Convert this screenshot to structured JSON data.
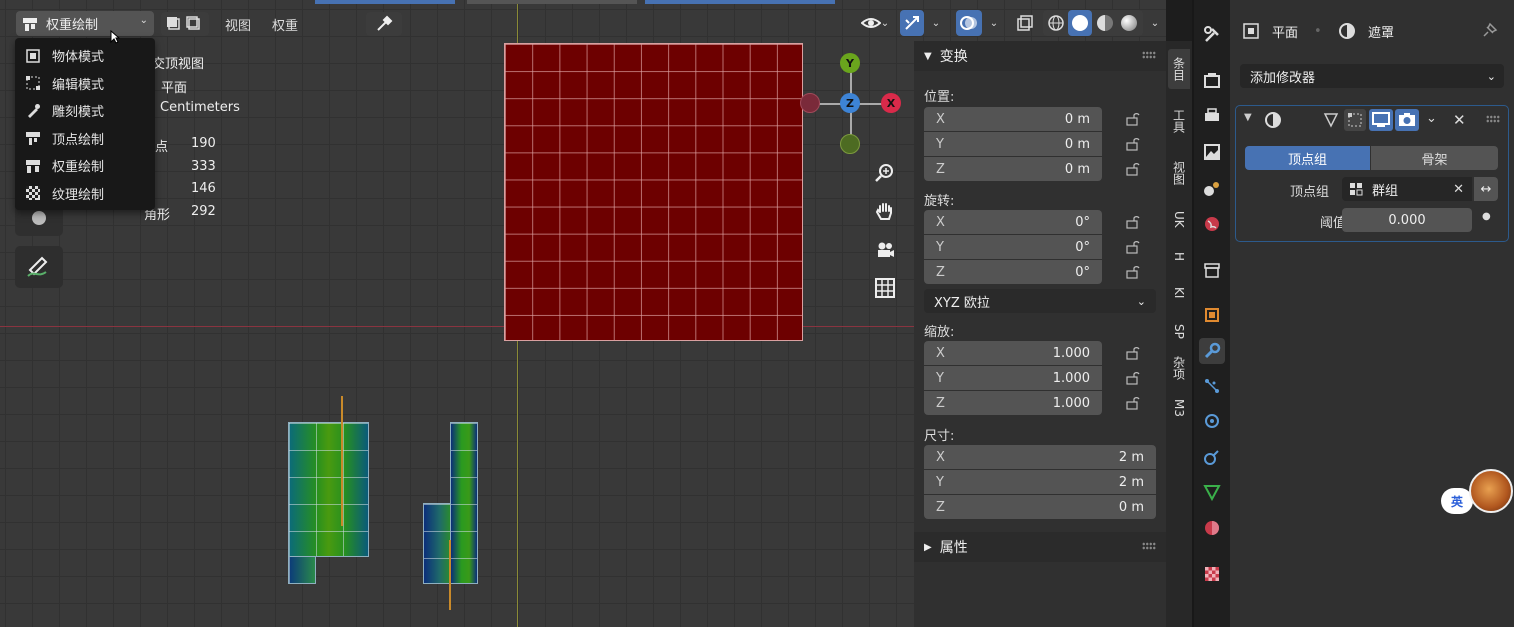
{
  "header": {
    "mode_label": "权重绘制",
    "view_menu": "视图",
    "weight_menu": "权重"
  },
  "mode_menu": {
    "items": [
      {
        "label": "物体模式",
        "icon": "object-mode-icon"
      },
      {
        "label": "编辑模式",
        "icon": "edit-mode-icon"
      },
      {
        "label": "雕刻模式",
        "icon": "sculpt-mode-icon"
      },
      {
        "label": "顶点绘制",
        "icon": "vertex-paint-icon"
      },
      {
        "label": "权重绘制",
        "icon": "weight-paint-icon"
      },
      {
        "label": "纹理绘制",
        "icon": "texture-paint-icon"
      }
    ]
  },
  "overlay": {
    "view_name": "交顶视图",
    "object_name": "平面",
    "units": "Centimeters",
    "stats": [
      {
        "label": "点",
        "value": "190"
      },
      {
        "label": "",
        "value": "333"
      },
      {
        "label": "",
        "value": "146"
      },
      {
        "label": "角形",
        "value": "292"
      }
    ]
  },
  "gizmo": {
    "x_label": "X",
    "y_label": "Y",
    "z_label": "Z"
  },
  "npanel": {
    "transform_title": "变换",
    "location_label": "位置:",
    "location": [
      {
        "axis": "X",
        "value": "0 m"
      },
      {
        "axis": "Y",
        "value": "0 m"
      },
      {
        "axis": "Z",
        "value": "0 m"
      }
    ],
    "rotation_label": "旋转:",
    "rotation": [
      {
        "axis": "X",
        "value": "0°"
      },
      {
        "axis": "Y",
        "value": "0°"
      },
      {
        "axis": "Z",
        "value": "0°"
      }
    ],
    "rotation_mode": "XYZ 欧拉",
    "scale_label": "缩放:",
    "scale": [
      {
        "axis": "X",
        "value": "1.000"
      },
      {
        "axis": "Y",
        "value": "1.000"
      },
      {
        "axis": "Z",
        "value": "1.000"
      }
    ],
    "dimensions_label": "尺寸:",
    "dimensions": [
      {
        "axis": "X",
        "value": "2 m"
      },
      {
        "axis": "Y",
        "value": "2 m"
      },
      {
        "axis": "Z",
        "value": "0 m"
      }
    ],
    "properties_title": "属性"
  },
  "vtabs": [
    "条目",
    "工具",
    "视图",
    "UK",
    "H",
    "KI",
    "SP",
    "杂项",
    "M3"
  ],
  "properties": {
    "object_name": "平面",
    "modifier_name": "遮罩",
    "add_modifier": "添加修改器",
    "mode_vertex_group": "顶点组",
    "mode_armature": "骨架",
    "vertex_group_label": "顶点组",
    "vertex_group_value": "群组",
    "threshold_label": "阈值",
    "threshold_value": "0.000"
  },
  "ime": {
    "lang": "英"
  },
  "colors": {
    "accent": "#4772b3",
    "mesh_red": "#6d0000",
    "axis_x": "#c8324a",
    "axis_y": "#6aa51d",
    "axis_z": "#3d83d5"
  }
}
